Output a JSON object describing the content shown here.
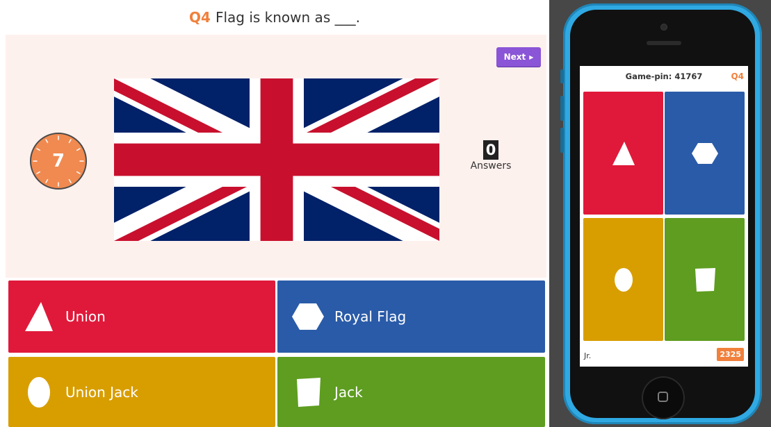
{
  "question": {
    "number": "Q4",
    "text": "Flag is known as ___."
  },
  "next_button": {
    "label": "Next"
  },
  "timer": {
    "value": "7"
  },
  "answers_counter": {
    "count": "0",
    "label": "Answers"
  },
  "answers": [
    {
      "label": "Union",
      "shape": "triangle-icon",
      "color": "#e0193a"
    },
    {
      "label": "Royal Flag",
      "shape": "hexagon-icon",
      "color": "#2a5ba8"
    },
    {
      "label": "Union Jack",
      "shape": "circle-icon",
      "color": "#d89e00"
    },
    {
      "label": "Jack",
      "shape": "square-icon",
      "color": "#5e9d20"
    }
  ],
  "phone": {
    "game_pin": "Game-pin: 41767",
    "question_number": "Q4",
    "player_name": "Jr.",
    "score": "2325",
    "frame_color": "#30a9e3"
  },
  "colors": {
    "accent": "#f0803c",
    "next_button": "#8a55d6",
    "stage_bg": "#fdf1ee"
  }
}
